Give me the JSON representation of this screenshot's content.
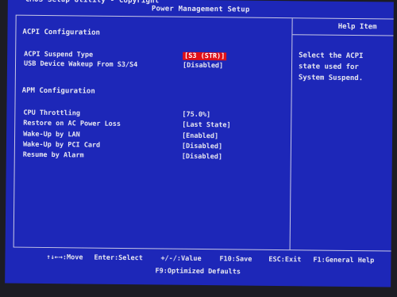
{
  "header": {
    "line1": "CMOS Setup Utility - Copyright",
    "line2": "Power Management Setup"
  },
  "help": {
    "title": "Help Item",
    "lines": [
      "Select the ACPI",
      "state used for",
      "System Suspend."
    ]
  },
  "acpi": {
    "heading": "ACPI Configuration",
    "items": [
      {
        "label": "ACPI Suspend Type",
        "value": "[S3 (STR)]"
      },
      {
        "label": "USB Device Wakeup From S3/S4",
        "value": "[Disabled]"
      }
    ]
  },
  "apm": {
    "heading": "APM Configuration",
    "items": [
      {
        "label": "CPU Throttling",
        "value": "[75.0%]"
      },
      {
        "label": "Restore on AC Power Loss",
        "value": "[Last State]"
      },
      {
        "label": "Wake-Up by LAN",
        "value": "[Enabled]"
      },
      {
        "label": "Wake-Up by PCI Card",
        "value": "[Disabled]"
      },
      {
        "label": "Resume by Alarm",
        "value": "[Disabled]"
      }
    ]
  },
  "footer": {
    "move": "↑↓←→:Move",
    "select": "Enter:Select",
    "value": "+/-/:Value",
    "save": "F10:Save",
    "exit": "ESC:Exit",
    "help": "F1:General Help",
    "defaults": "F9:Optimized Defaults"
  },
  "colors": {
    "background": "#1d27b8",
    "highlight": "#e01018",
    "text": "#e6e6f0"
  }
}
